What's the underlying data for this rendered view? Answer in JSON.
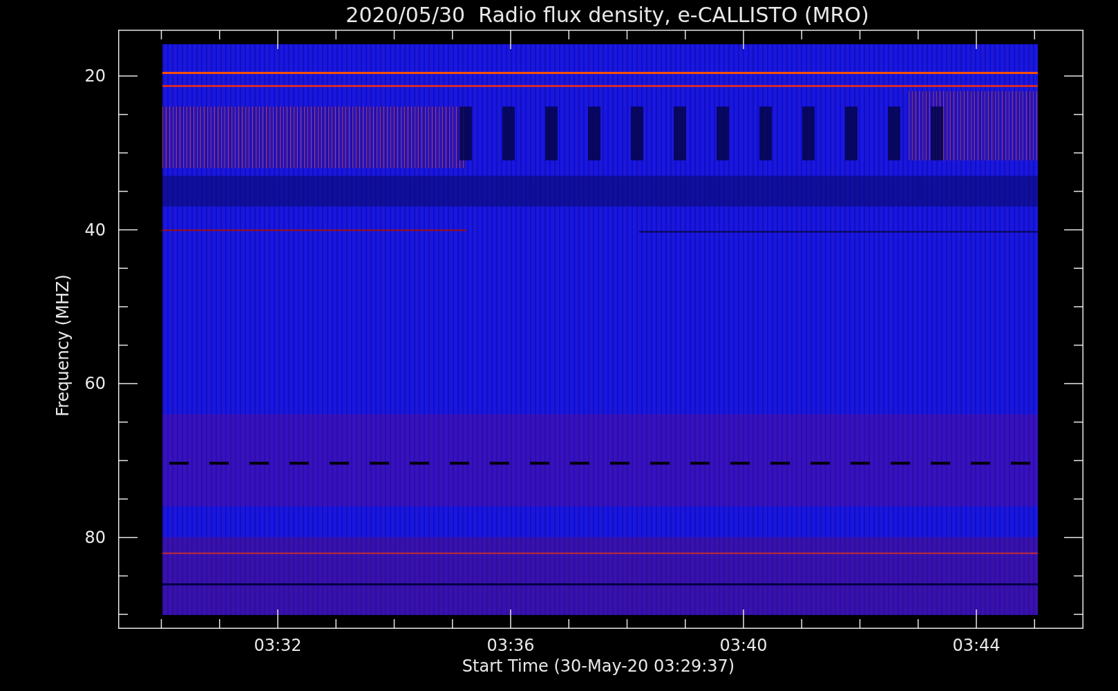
{
  "title": "2020/05/30  Radio flux density, e-CALLISTO (MRO)",
  "y_axis": {
    "label": "Frequency (MHZ)",
    "ticks": [
      "20",
      "40",
      "60",
      "80"
    ]
  },
  "x_axis": {
    "label": "Start Time (30-May-20 03:29:37)",
    "ticks": [
      "03:32",
      "03:36",
      "03:40",
      "03:44"
    ]
  }
}
